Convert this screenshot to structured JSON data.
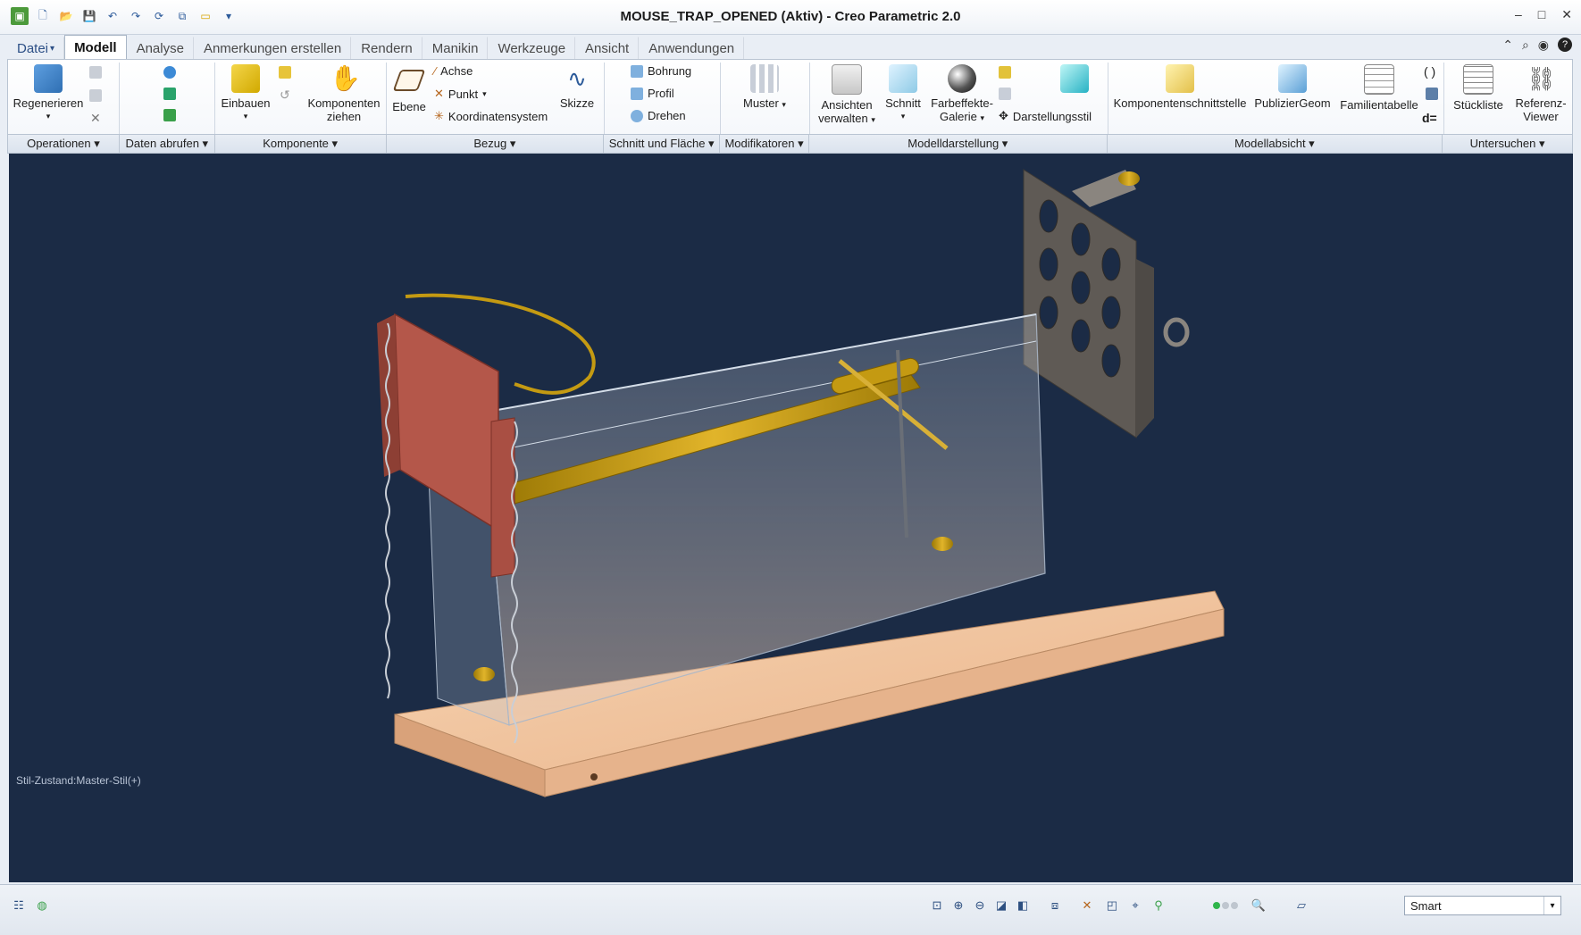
{
  "window": {
    "title": "MOUSE_TRAP_OPENED (Aktiv) - Creo Parametric 2.0",
    "controls": [
      "–",
      "□",
      "✕"
    ]
  },
  "quick_access": [
    "new-icon",
    "open-icon",
    "save-icon",
    "undo-icon",
    "redo-icon",
    "regenerate-icon",
    "windows-icon",
    "close-window-icon"
  ],
  "menu_tabs": [
    {
      "label": "Datei",
      "suffix": "▾"
    },
    {
      "label": "Modell"
    },
    {
      "label": "Analyse"
    },
    {
      "label": "Anmerkungen erstellen"
    },
    {
      "label": "Rendern"
    },
    {
      "label": "Manikin"
    },
    {
      "label": "Werkzeuge"
    },
    {
      "label": "Ansicht"
    },
    {
      "label": "Anwendungen"
    }
  ],
  "ribbon": {
    "regenerieren": "Regenerieren",
    "einbauen": "Einbauen",
    "komponenten_ziehen": [
      "Komponenten",
      "ziehen"
    ],
    "ebene": "Ebene",
    "achse": "Achse",
    "punkt": "Punkt",
    "koordinatensystem": "Koordinatensystem",
    "skizze": "Skizze",
    "bohrung": "Bohrung",
    "profil": "Profil",
    "drehen": "Drehen",
    "muster": "Muster",
    "ansichten_verwalten": [
      "Ansichten",
      "verwalten"
    ],
    "schnitt": "Schnitt",
    "farbeffekte_galerie": [
      "Farbeffekte-",
      "Galerie"
    ],
    "darstellungsstil": "Darstellungsstil",
    "komponentenschnittstelle": "Komponentenschnittstelle",
    "publiziergeom": "PublizierGeom",
    "familientabelle": "Familientabelle",
    "stueckliste": "Stückliste",
    "referenz_viewer": [
      "Referenz-",
      "Viewer"
    ],
    "relations_symbol": "d="
  },
  "groups": [
    {
      "label": "Operationen ▾"
    },
    {
      "label": "Daten abrufen ▾"
    },
    {
      "label": "Komponente ▾"
    },
    {
      "label": "Bezug ▾"
    },
    {
      "label": "Schnitt und Fläche ▾"
    },
    {
      "label": "Modifikatoren ▾"
    },
    {
      "label": "Modelldarstellung ▾"
    },
    {
      "label": "Modellabsicht ▾"
    },
    {
      "label": "Untersuchen ▾"
    }
  ],
  "viewport": {
    "style_state": "Stil-Zustand:Master-Stil(+)",
    "background": "#1b2b45"
  },
  "status": {
    "filter_value": "Smart"
  },
  "colors": {
    "accent": "#2d5b9a",
    "door": "#b4574a",
    "brass": "#c49a12",
    "wood": "#f2c39c",
    "plate": "#6b6660"
  }
}
